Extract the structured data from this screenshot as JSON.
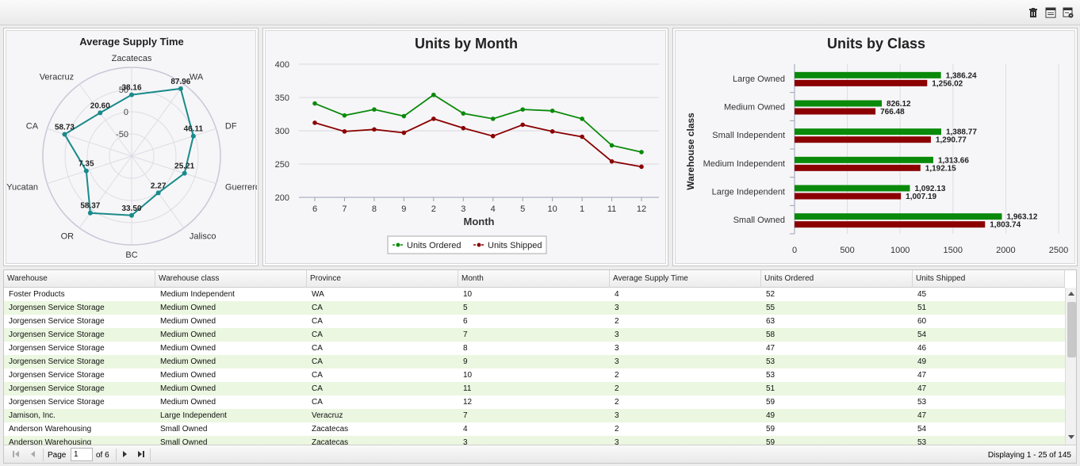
{
  "toolbar": {
    "icons": [
      "trash-icon",
      "export-grid-icon",
      "settings-grid-icon"
    ]
  },
  "radar": {
    "title": "Average Supply Time",
    "axis_labels": [
      "Zacatecas",
      "WA",
      "DF",
      "Guerrero",
      "Jalisco",
      "BC",
      "OR",
      "Yucatan",
      "CA",
      "Veracruz"
    ],
    "tick_labels": [
      "50",
      "0",
      "-50"
    ],
    "color": "#1a8a8a"
  },
  "line": {
    "title": "Units by Month",
    "xlabel": "Month",
    "y_ticks": [
      "400",
      "350",
      "300",
      "250",
      "200"
    ],
    "legend": [
      "Units Ordered",
      "Units Shipped"
    ],
    "colors": [
      "#0a8a0a",
      "#8b0000"
    ]
  },
  "hbar": {
    "title": "Units by Class",
    "ylabel": "Warehouse class",
    "x_ticks": [
      "0",
      "500",
      "1000",
      "1500",
      "2000",
      "2500"
    ],
    "colors": [
      "#0a8a0a",
      "#8b0000"
    ]
  },
  "chart_data": [
    {
      "type": "radar",
      "title": "Average Supply Time",
      "categories": [
        "Zacatecas",
        "WA",
        "DF",
        "Guerrero",
        "Jalisco",
        "BC",
        "OR",
        "Yucatan",
        "CA",
        "Veracruz"
      ],
      "values": [
        38.16,
        87.96,
        46.11,
        25.21,
        2.27,
        33.5,
        58.37,
        7.35,
        58.73,
        20.6
      ],
      "value_labels": [
        "38.16",
        "87.96",
        "46.11",
        "25.21",
        "2.27",
        "33.50",
        "58.37",
        "7.35",
        "58.73",
        "20.60"
      ],
      "rlim": [
        -100,
        100
      ]
    },
    {
      "type": "line",
      "title": "Units by Month",
      "xlabel": "Month",
      "categories": [
        "6",
        "7",
        "8",
        "9",
        "2",
        "3",
        "4",
        "5",
        "10",
        "1",
        "11",
        "12"
      ],
      "series": [
        {
          "name": "Units Ordered",
          "values": [
            341,
            323,
            332,
            322,
            354,
            326,
            318,
            332,
            330,
            318,
            278,
            268
          ]
        },
        {
          "name": "Units Shipped",
          "values": [
            312,
            299,
            302,
            297,
            318,
            304,
            292,
            309,
            299,
            291,
            254,
            246
          ]
        }
      ],
      "ylim": [
        200,
        400
      ],
      "legend": "bottom"
    },
    {
      "type": "bar",
      "orientation": "horizontal",
      "title": "Units by Class",
      "ylabel": "Warehouse class",
      "categories": [
        "Large Owned",
        "Medium Owned",
        "Small Independent",
        "Medium Independent",
        "Large Independent",
        "Small Owned"
      ],
      "series": [
        {
          "values": [
            1386.24,
            826.12,
            1388.77,
            1313.66,
            1092.13,
            1963.12
          ],
          "labels": [
            "1,386.24",
            "826.12",
            "1,388.77",
            "1,313.66",
            "1,092.13",
            "1,963.12"
          ]
        },
        {
          "values": [
            1256.02,
            766.48,
            1290.77,
            1192.15,
            1007.19,
            1803.74
          ],
          "labels": [
            "1,256.02",
            "766.48",
            "1,290.77",
            "1,192.15",
            "1,007.19",
            "1,803.74"
          ]
        }
      ],
      "xlim": [
        0,
        2500
      ]
    }
  ],
  "grid": {
    "columns": [
      "Warehouse",
      "Warehouse class",
      "Province",
      "Month",
      "Average Supply Time",
      "Units Ordered",
      "Units Shipped"
    ],
    "rows": [
      [
        "Foster Products",
        "Medium Independent",
        "WA",
        "10",
        "4",
        "52",
        "45"
      ],
      [
        "Jorgensen Service Storage",
        "Medium Owned",
        "CA",
        "5",
        "3",
        "55",
        "51"
      ],
      [
        "Jorgensen Service Storage",
        "Medium Owned",
        "CA",
        "6",
        "2",
        "63",
        "60"
      ],
      [
        "Jorgensen Service Storage",
        "Medium Owned",
        "CA",
        "7",
        "3",
        "58",
        "54"
      ],
      [
        "Jorgensen Service Storage",
        "Medium Owned",
        "CA",
        "8",
        "3",
        "47",
        "46"
      ],
      [
        "Jorgensen Service Storage",
        "Medium Owned",
        "CA",
        "9",
        "3",
        "53",
        "49"
      ],
      [
        "Jorgensen Service Storage",
        "Medium Owned",
        "CA",
        "10",
        "2",
        "53",
        "47"
      ],
      [
        "Jorgensen Service Storage",
        "Medium Owned",
        "CA",
        "11",
        "2",
        "51",
        "47"
      ],
      [
        "Jorgensen Service Storage",
        "Medium Owned",
        "CA",
        "12",
        "2",
        "59",
        "53"
      ],
      [
        "Jamison, Inc.",
        "Large Independent",
        "Veracruz",
        "7",
        "3",
        "49",
        "47"
      ],
      [
        "Anderson Warehousing",
        "Small Owned",
        "Zacatecas",
        "4",
        "2",
        "59",
        "54"
      ],
      [
        "Anderson Warehousing",
        "Small Owned",
        "Zacatecas",
        "3",
        "3",
        "59",
        "53"
      ]
    ]
  },
  "pager": {
    "page_label": "Page",
    "page_value": "1",
    "of_label": "of 6",
    "display_text": "Displaying 1 - 25 of 145"
  }
}
